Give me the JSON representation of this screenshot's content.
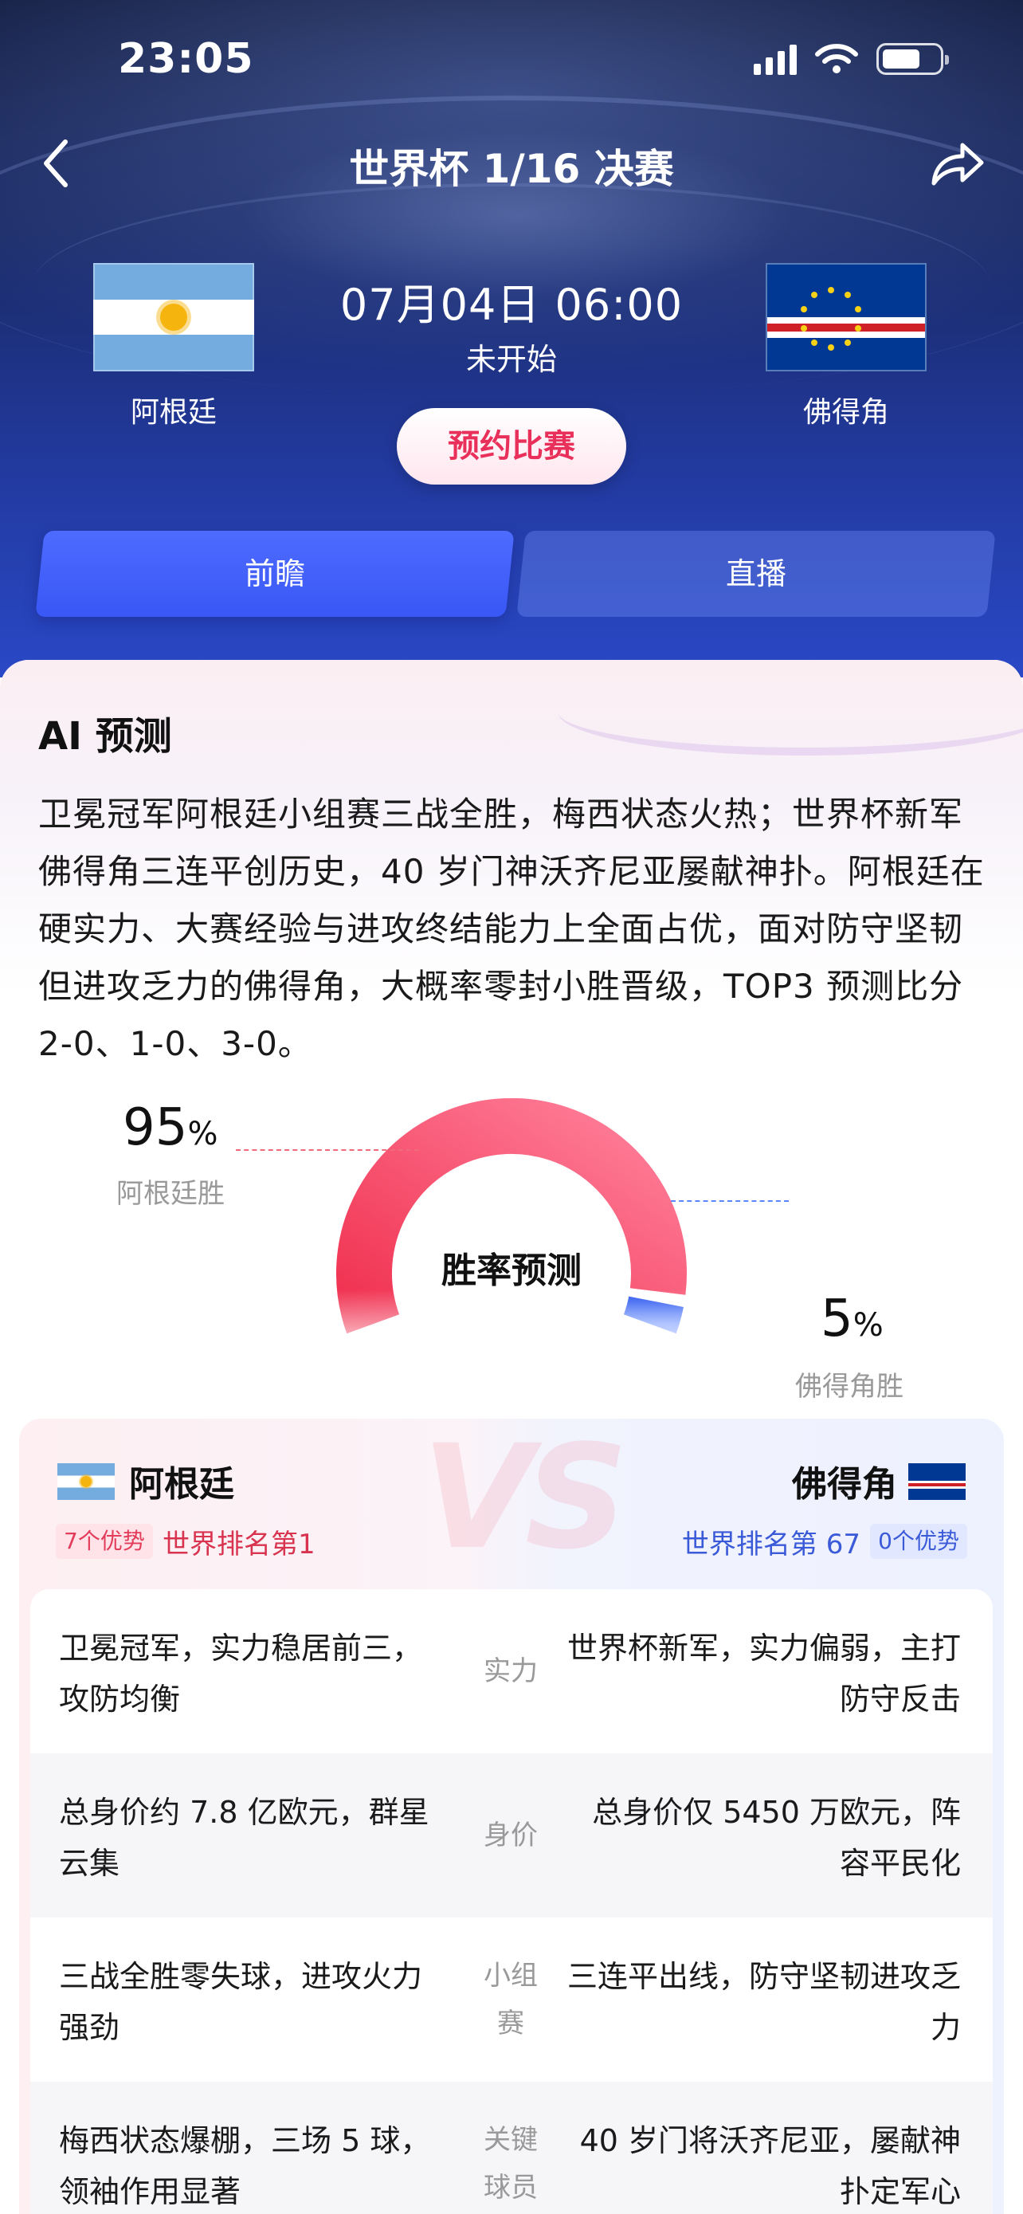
{
  "status_bar": {
    "time": "23:05"
  },
  "header": {
    "title": "世界杯 1/16 决赛",
    "match_time": "07月04日 06:00",
    "match_status": "未开始",
    "reserve_button": "预约比赛",
    "team_home": "阿根廷",
    "team_away": "佛得角"
  },
  "tabs": [
    {
      "label": "前瞻",
      "active": true
    },
    {
      "label": "直播",
      "active": false
    }
  ],
  "ai_prediction": {
    "title": "AI 预测",
    "text": "卫冕冠军阿根廷小组赛三战全胜，梅西状态火热；世界杯新军佛得角三连平创历史，40 岁门神沃齐尼亚屡献神扑。阿根廷在硬实力、大赛经验与进攻终结能力上全面占优，面对防守坚韧但进攻乏力的佛得角，大概率零封小胜晋级，TOP3 预测比分 2-0、1-0、3-0。"
  },
  "win_rate": {
    "label": "胜率预测",
    "home_pct": "95",
    "home_label": "阿根廷胜",
    "away_pct": "5",
    "away_label": "佛得角胜",
    "percent_sign": "%",
    "home_color": "#f0435e",
    "away_color": "#3a62f5"
  },
  "comparison": {
    "vs": "VS",
    "home": {
      "name": "阿根廷",
      "advantages": "7个优势",
      "rank": "世界排名第1"
    },
    "away": {
      "name": "佛得角",
      "advantages": "0个优势",
      "rank": "世界排名第 67"
    },
    "rows": [
      {
        "home": "卫冕冠军，实力稳居前三，攻防均衡",
        "category": "实力",
        "away": "世界杯新军，实力偏弱，主打防守反击"
      },
      {
        "home": "总身价约 7.8 亿欧元，群星云集",
        "category": "身价",
        "away": "总身价仅 5450 万欧元，阵容平民化"
      },
      {
        "home": "三战全胜零失球，进攻火力强劲",
        "category": "小组赛",
        "away": "三连平出线，防守坚韧进攻乏力"
      },
      {
        "home": "梅西状态爆棚，三场 5 球，领袖作用显著",
        "category": "关键球员",
        "away": "40 岁门将沃齐尼亚，屡献神扑定军心"
      }
    ]
  }
}
